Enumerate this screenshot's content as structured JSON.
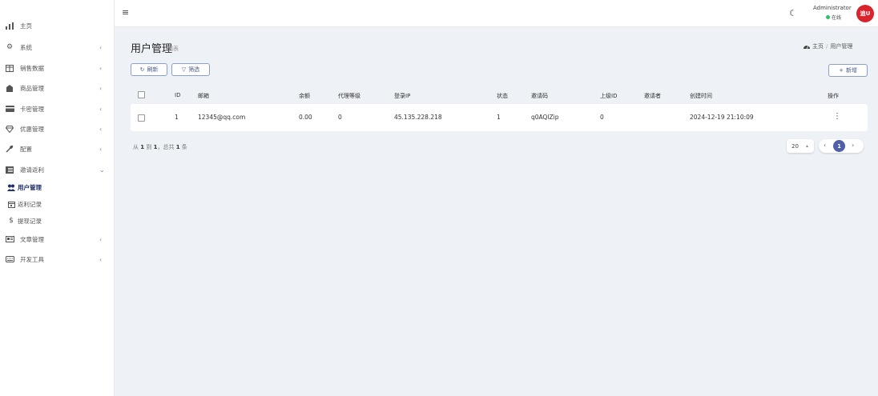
{
  "sidebar": {
    "items": [
      {
        "label": "主页",
        "icon": "bar-chart-icon",
        "chevron": ""
      },
      {
        "label": "系统",
        "icon": "gear-icon",
        "chevron": "‹"
      },
      {
        "label": "销售数据",
        "icon": "table-icon",
        "chevron": "‹"
      },
      {
        "label": "商品管理",
        "icon": "box-icon",
        "chevron": "‹"
      },
      {
        "label": "卡密管理",
        "icon": "card-icon",
        "chevron": "‹"
      },
      {
        "label": "优惠管理",
        "icon": "diamond-icon",
        "chevron": "‹"
      },
      {
        "label": "配置",
        "icon": "wrench-icon",
        "chevron": "‹"
      },
      {
        "label": "邀请返利",
        "icon": "list-icon",
        "chevron": "⌄"
      },
      {
        "label": "用户管理",
        "icon": "users-icon",
        "chevron": ""
      },
      {
        "label": "返利记录",
        "icon": "calendar-icon",
        "chevron": ""
      },
      {
        "label": "提现记录",
        "icon": "dollar-icon",
        "chevron": ""
      },
      {
        "label": "文章管理",
        "icon": "article-icon",
        "chevron": "‹"
      },
      {
        "label": "开发工具",
        "icon": "keyboard-icon",
        "chevron": "‹"
      }
    ]
  },
  "header": {
    "username": "Administrator",
    "status": "在线",
    "avatar_text": "追U",
    "avatar_color": "#d9232d"
  },
  "page": {
    "title": "用户管理",
    "subtitle": "列表",
    "breadcrumb": [
      "主页",
      "用户管理"
    ]
  },
  "toolbar": {
    "refresh_label": "刷新",
    "filter_label": "筛选",
    "add_label": "新增"
  },
  "table": {
    "columns": [
      "ID",
      "邮箱",
      "余额",
      "代理等级",
      "登录IP",
      "状态",
      "邀请码",
      "上级ID",
      "邀请者",
      "创建时间",
      "操作"
    ],
    "rows": [
      {
        "id": "1",
        "email": "12345@qq.com",
        "balance": "0.00",
        "level": "0",
        "ip": "45.135.228.218",
        "status": "1",
        "invite_code": "q0AQlZip",
        "parent_id": "0",
        "inviter": "",
        "created": "2024-12-19 21:10:09"
      }
    ]
  },
  "pagination": {
    "summary_prefix": "从",
    "from": "1",
    "to_word": "到",
    "to": "1",
    "total_word": "，总共",
    "total": "1",
    "suffix": "条",
    "page_size": "20",
    "current_page": "1"
  },
  "colors": {
    "accent": "#4f5fa8",
    "online": "#22c55e"
  }
}
